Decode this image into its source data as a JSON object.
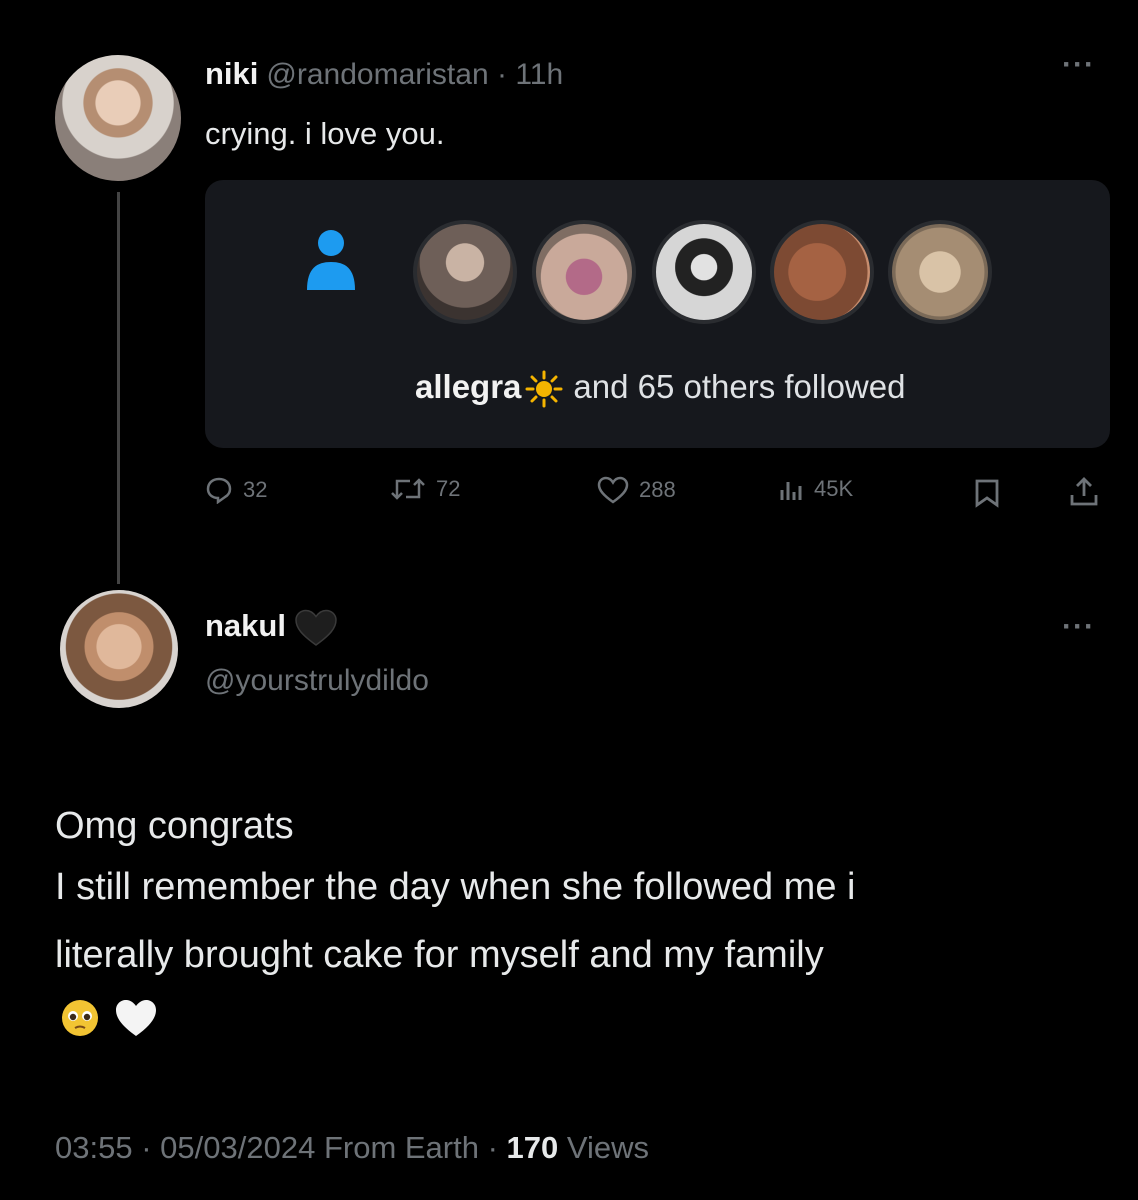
{
  "tweet": {
    "author_name": "niki",
    "handle": "@randomaristan",
    "separator": "·",
    "time_ago": "11h",
    "text": "crying. i love you.",
    "more": "···",
    "notification": {
      "follower_name": "allegra",
      "follow_text": "and 65 others followed"
    },
    "stats": {
      "replies": "32",
      "retweets": "72",
      "likes": "288",
      "views": "45K"
    }
  },
  "reply": {
    "author_name": "nakul",
    "handle": "@yourstrulydildo",
    "more": "···",
    "body_lines": [
      "Omg congrats",
      "I still remember the day when she followed me i",
      "literally brought cake for myself and my family"
    ],
    "emojis": [
      "pleading-face",
      "white-heart"
    ],
    "footer": {
      "time": "03:55",
      "date": "05/03/2024",
      "source": "From Earth",
      "separator": "·",
      "views_count": "170",
      "views_label": "Views"
    }
  },
  "colors": {
    "background": "#000000",
    "card": "#16181d",
    "muted": "#6e7378",
    "person_icon": "#1d9bf0"
  }
}
